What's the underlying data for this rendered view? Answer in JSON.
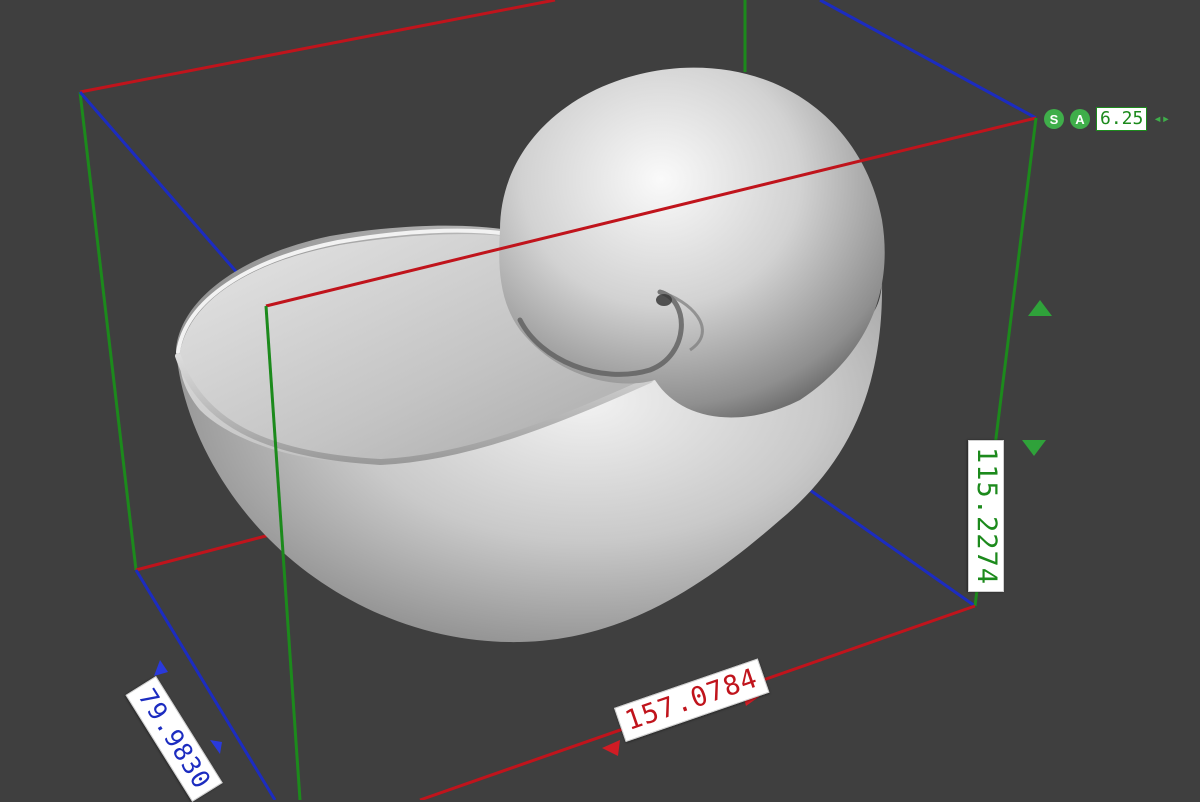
{
  "viewport": {
    "background_color": "#3f3f3f",
    "model": "nautilus shell"
  },
  "bounding_box": {
    "x_axis_color": "#c0141c",
    "y_axis_color": "#1c8a1c",
    "z_axis_color": "#1c2cc0"
  },
  "dimensions": {
    "width": "157.0784",
    "height": "115.2274",
    "depth": "79.9830"
  },
  "gizmo": {
    "snap_label": "S",
    "angle_label": "A",
    "value": "6.25",
    "arrows": "◂▸"
  }
}
